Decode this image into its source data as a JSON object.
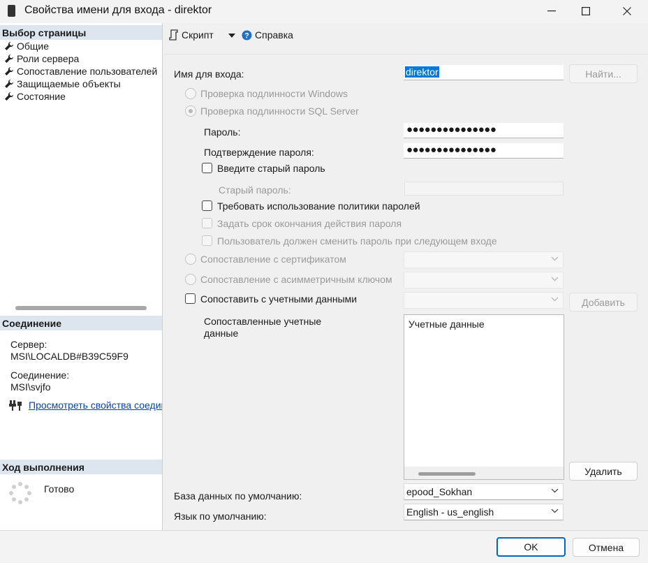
{
  "window": {
    "title": "Свойства имени для входа - direktor"
  },
  "sidebar": {
    "page_select_header": "Выбор страницы",
    "items": [
      {
        "label": "Общие"
      },
      {
        "label": "Роли сервера"
      },
      {
        "label": "Сопоставление пользователей"
      },
      {
        "label": "Защищаемые объекты"
      },
      {
        "label": "Состояние"
      }
    ],
    "connection_header": "Соединение",
    "server_label": "Сервер:",
    "server_value": "MSI\\LOCALDB#B39C59F9",
    "connection_label": "Соединение:",
    "connection_value": "MSI\\svjfo",
    "view_props_link": "Просмотреть свойства соединения",
    "progress_header": "Ход выполнения",
    "progress_status": "Готово"
  },
  "toolbar": {
    "script_label": "Скрипт",
    "help_label": "Справка"
  },
  "form": {
    "login_name_label": "Имя для входа:",
    "login_name_value": "direktor",
    "find_button": "Найти...",
    "auth_windows": "Проверка подлинности Windows",
    "auth_sql": "Проверка подлинности SQL Server",
    "password_label": "Пароль:",
    "password_value": "●●●●●●●●●●●●●●●",
    "confirm_label": "Подтверждение пароля:",
    "confirm_value": "●●●●●●●●●●●●●●●",
    "old_password_check": "Введите старый пароль",
    "old_password_label": "Старый пароль:",
    "enforce_policy": "Требовать использование политики паролей",
    "enforce_expiration": "Задать срок окончания действия пароля",
    "must_change": "Пользователь должен сменить пароль при следующем входе",
    "map_certificate": "Сопоставление с сертификатом",
    "map_asym_key": "Сопоставление с асимметричным ключом",
    "map_credential": "Сопоставить с учетными данными",
    "add_button": "Добавить",
    "mapped_credentials_label_1": "Сопоставленные учетные",
    "mapped_credentials_label_2": "данные",
    "credentials_column": "Учетные данные",
    "remove_button": "Удалить",
    "default_db_label": "База данных по умолчанию:",
    "default_db_value": "epood_Sokhan",
    "default_lang_label": "Язык по умолчанию:",
    "default_lang_value": "English - us_english"
  },
  "footer": {
    "ok_button": "OK",
    "cancel_button": "Отмена"
  },
  "colors": {
    "accent": "#0067c0",
    "selection": "#0078d7",
    "section_header": "#dde6ef"
  }
}
